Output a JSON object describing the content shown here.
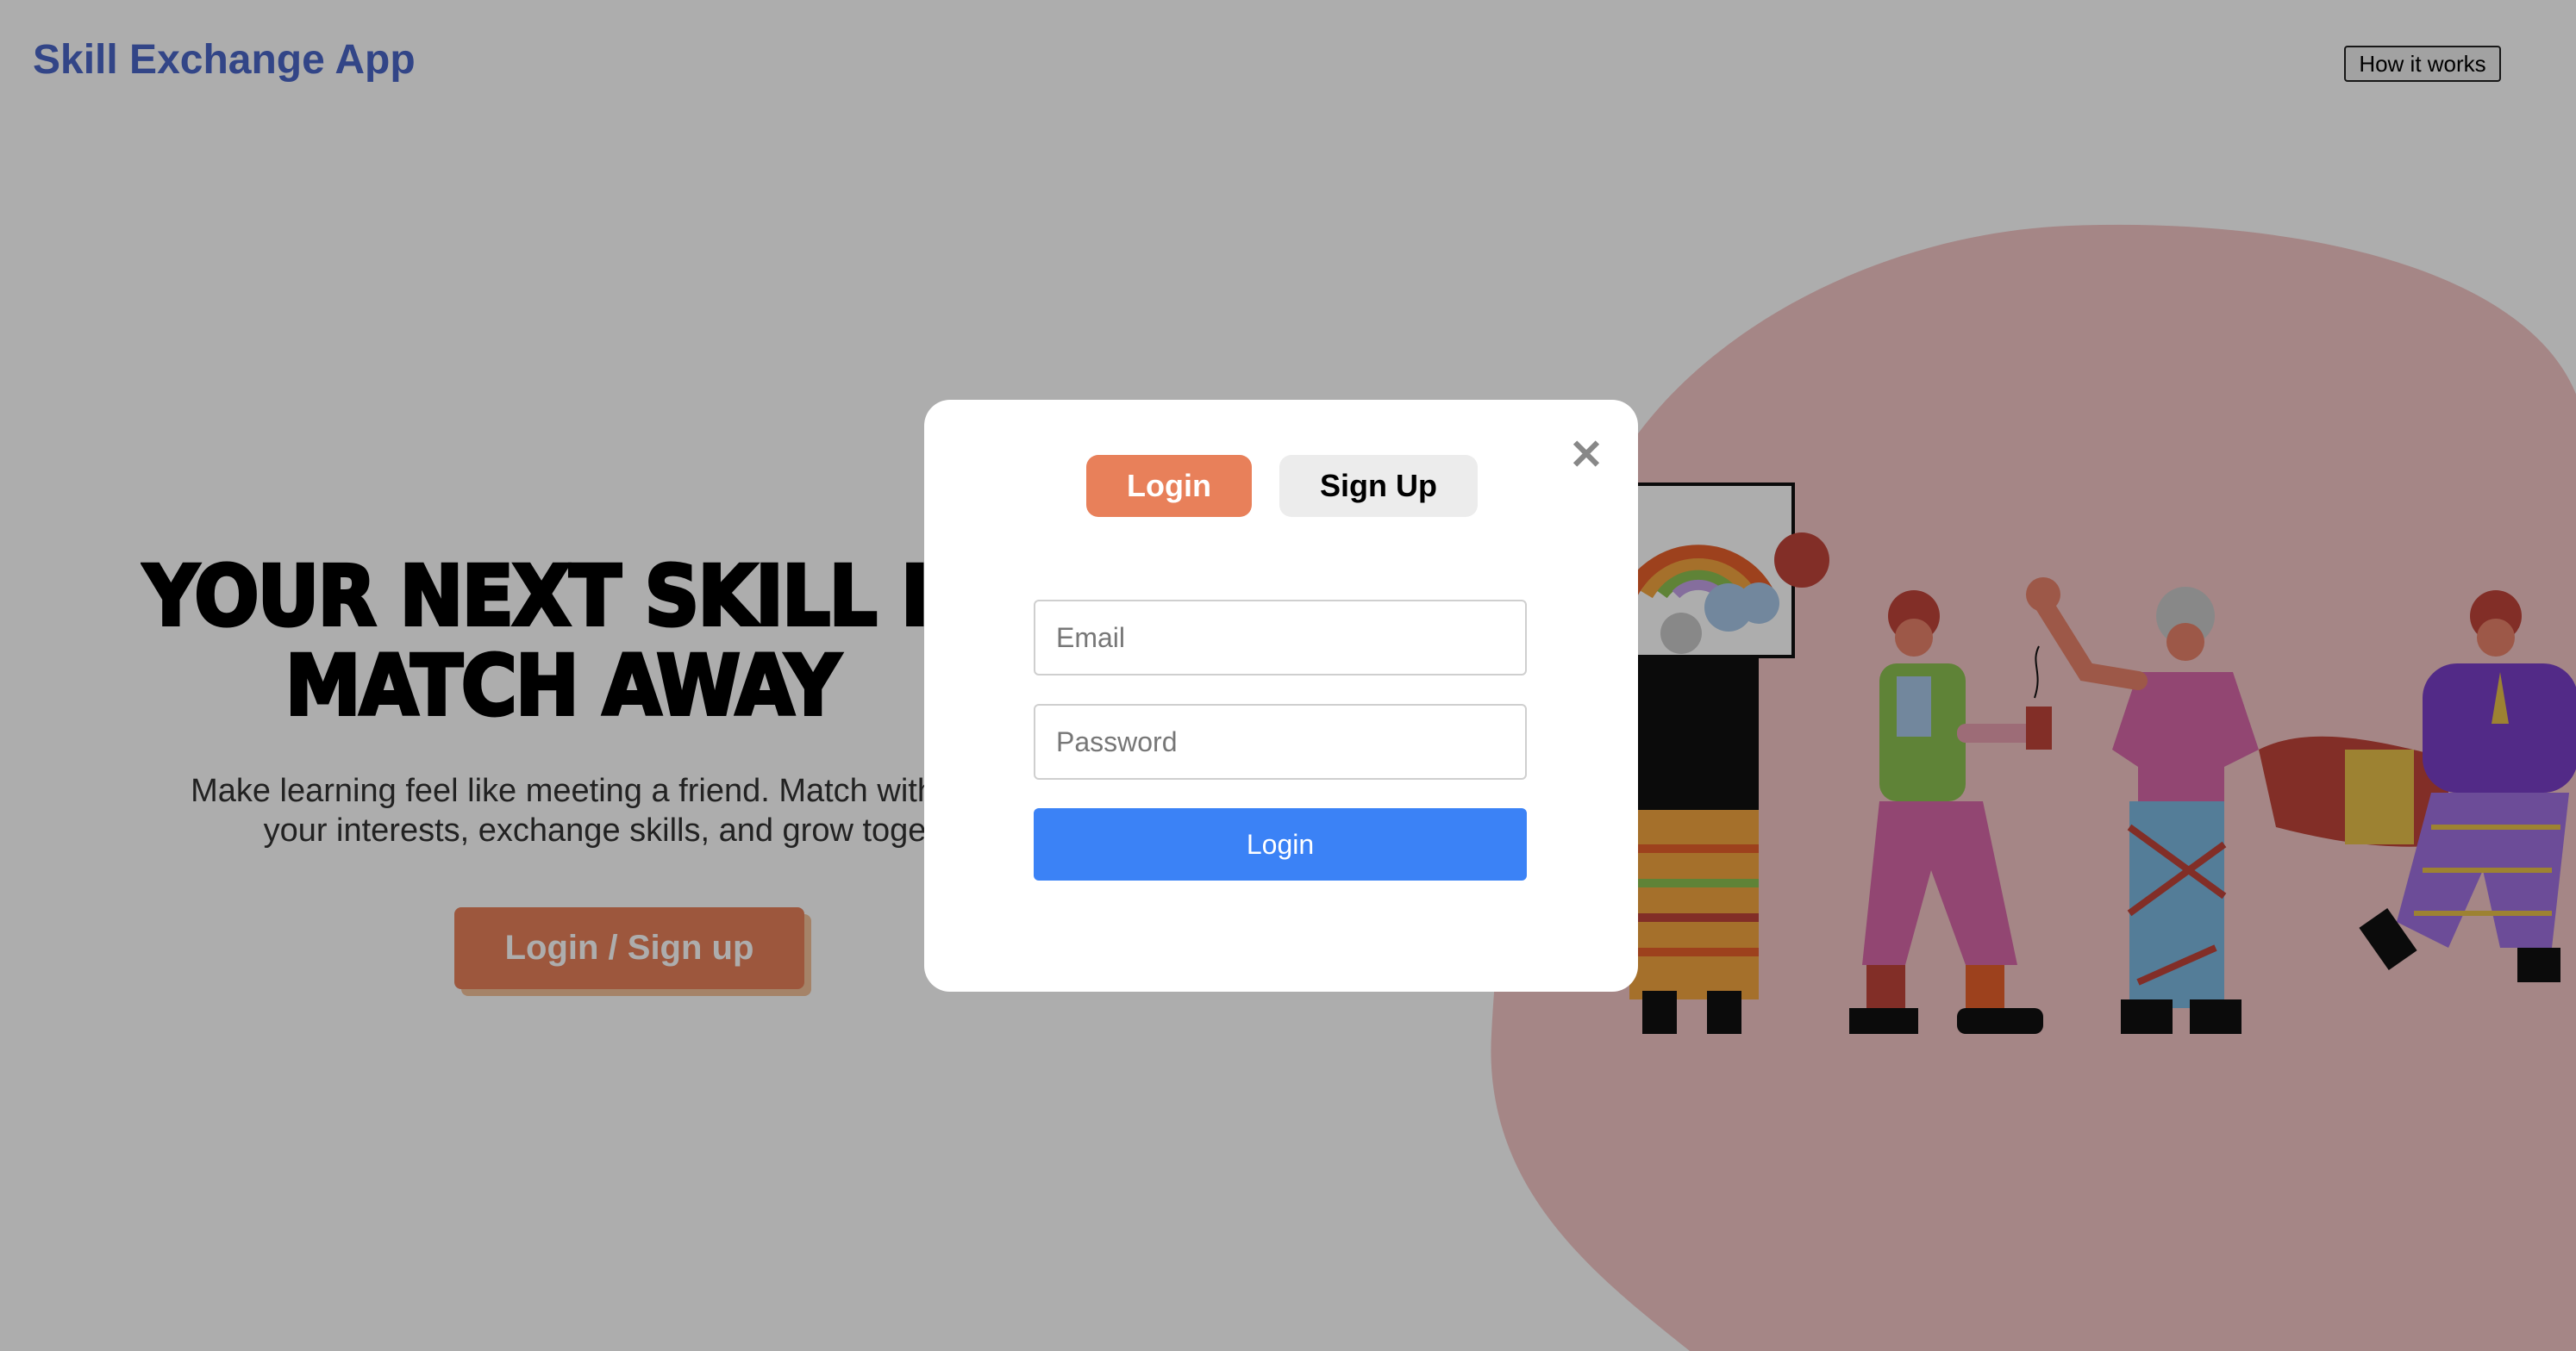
{
  "header": {
    "app_title": "Skill Exchange App",
    "how_it_works_label": "How it works"
  },
  "hero": {
    "title_line1": "YOUR NEXT SKILL IS",
    "title_line2": "MATCH AWAY",
    "subtitle_line1": "Make learning feel like meeting a friend. Match with peo",
    "subtitle_line2": "your interests, exchange skills, and grow toge",
    "cta_label": "Login / Sign up"
  },
  "modal": {
    "tabs": [
      {
        "label": "Login",
        "active": true
      },
      {
        "label": "Sign Up",
        "active": false
      }
    ],
    "close_symbol": "✕",
    "email": {
      "placeholder": "Email",
      "value": ""
    },
    "password": {
      "placeholder": "Password",
      "value": ""
    },
    "submit_label": "Login"
  },
  "colors": {
    "brand": "#4a66c8",
    "accent_orange": "#e8805a",
    "primary_blue": "#3b82f6",
    "blob_pink": "#f4c6c6",
    "overlay": "rgba(0,0,0,0.32)"
  }
}
